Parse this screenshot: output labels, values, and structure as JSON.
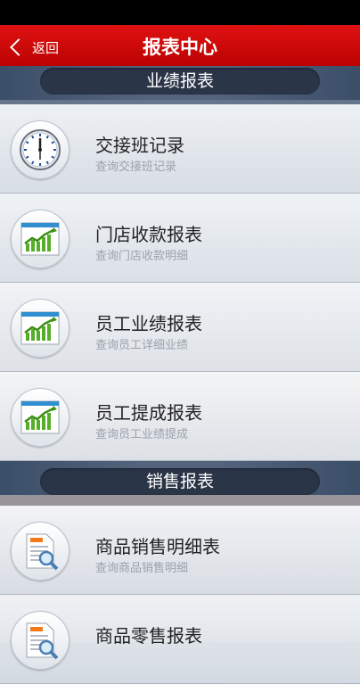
{
  "header": {
    "back_label": "返回",
    "title": "报表中心"
  },
  "sections": [
    {
      "title": "业绩报表",
      "items": [
        {
          "title": "交接班记录",
          "subtitle": "查询交接班记录",
          "icon": "clock-icon"
        },
        {
          "title": "门店收款报表",
          "subtitle": "查询门店收款明细",
          "icon": "chart-icon"
        },
        {
          "title": "员工业绩报表",
          "subtitle": "查询员工详细业绩",
          "icon": "chart-icon"
        },
        {
          "title": "员工提成报表",
          "subtitle": "查询员工业绩提成",
          "icon": "chart-icon"
        }
      ]
    },
    {
      "title": "销售报表",
      "items": [
        {
          "title": "商品销售明细表",
          "subtitle": "查询商品销售明细",
          "icon": "document-search-icon"
        },
        {
          "title": "商品零售报表",
          "subtitle": "",
          "icon": "document-search-icon"
        }
      ]
    }
  ],
  "colors": {
    "titlebar": "#d00000",
    "section_pill": "#2a3547",
    "chart_green": "#4a9e1e"
  }
}
